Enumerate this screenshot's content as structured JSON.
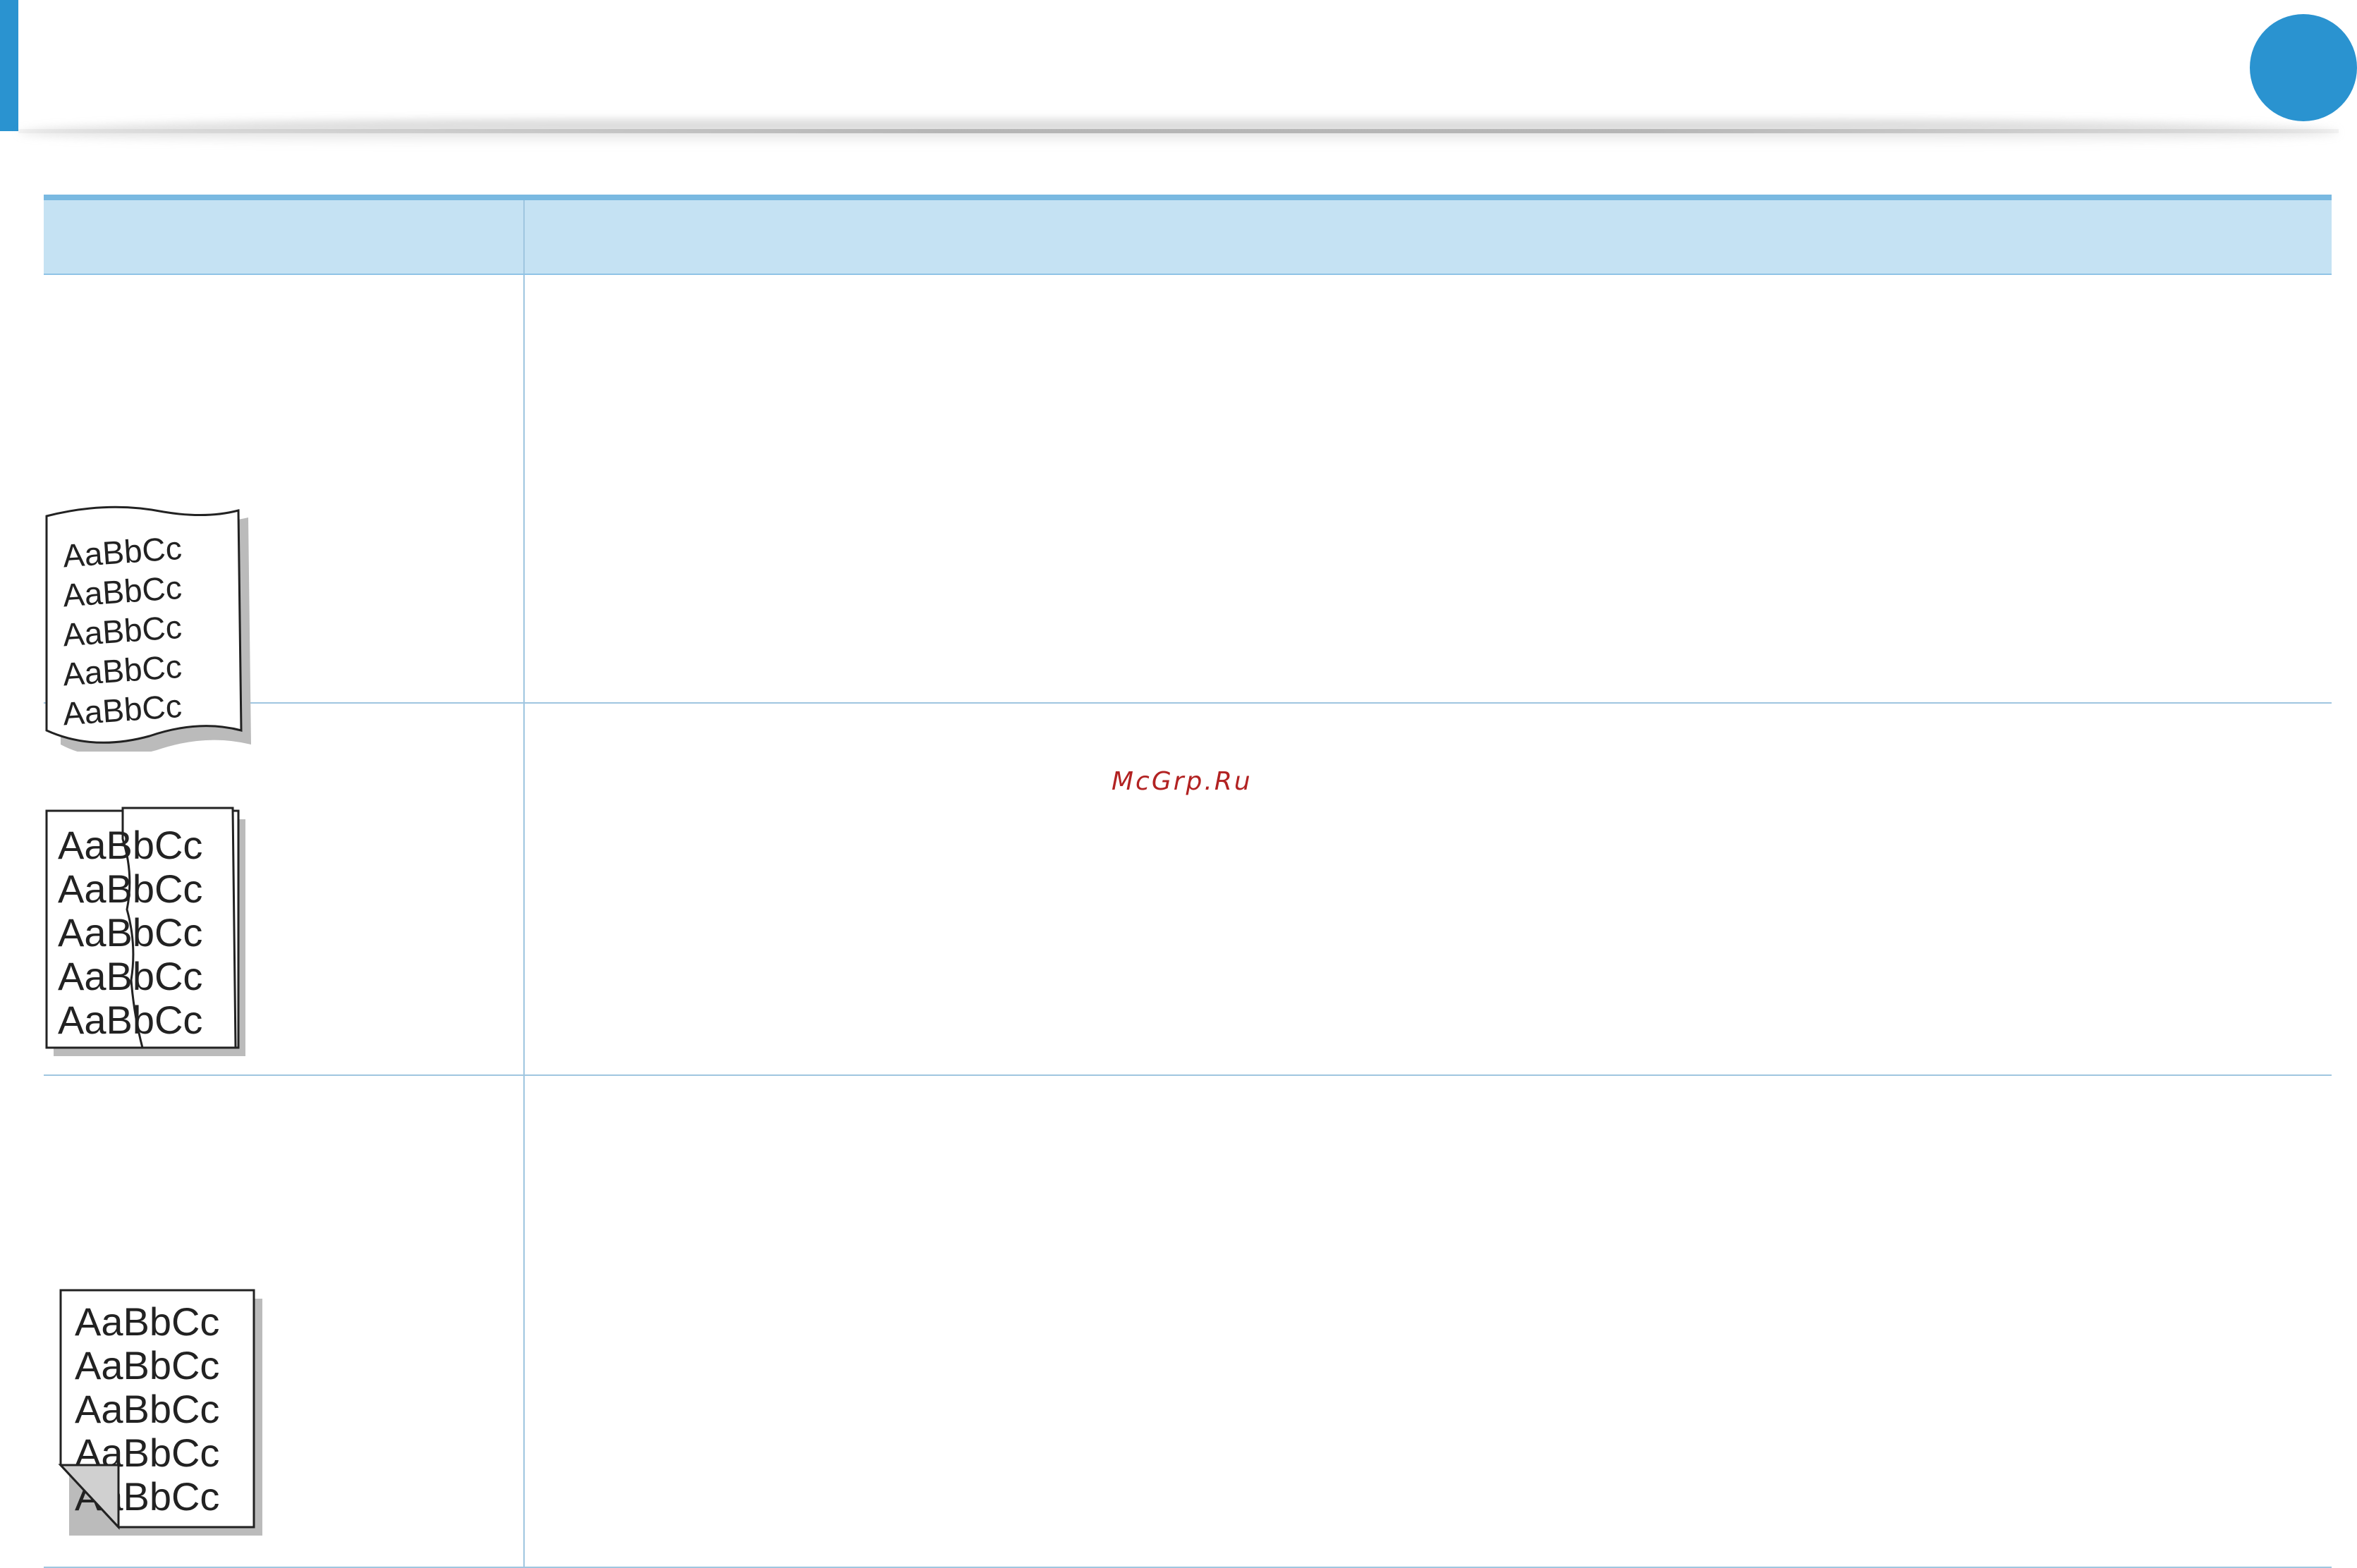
{
  "watermark": {
    "text": "McGrp.Ru"
  },
  "samples": {
    "curl": {
      "icon": "curled-paper-sample-icon",
      "lines": [
        "AaBbCc",
        "AaBbCc",
        "AaBbCc",
        "AaBbCc",
        "AaBbCc"
      ]
    },
    "torn": {
      "icon": "torn-paper-sample-icon",
      "lines": [
        "AaBbCc",
        "AaBbCc",
        "AaBbCc",
        "AaBbCc",
        "AaBbCc"
      ]
    },
    "folded": {
      "icon": "folded-corner-sample-icon",
      "lines": [
        "AaBbCc",
        "AaBbCc",
        "AaBbCc",
        "AaBbCc",
        "AaBbCc"
      ]
    }
  },
  "colors": {
    "accent": "#2a93d0",
    "header_fill": "#c5e2f3",
    "rule": "#9fc6e0"
  }
}
